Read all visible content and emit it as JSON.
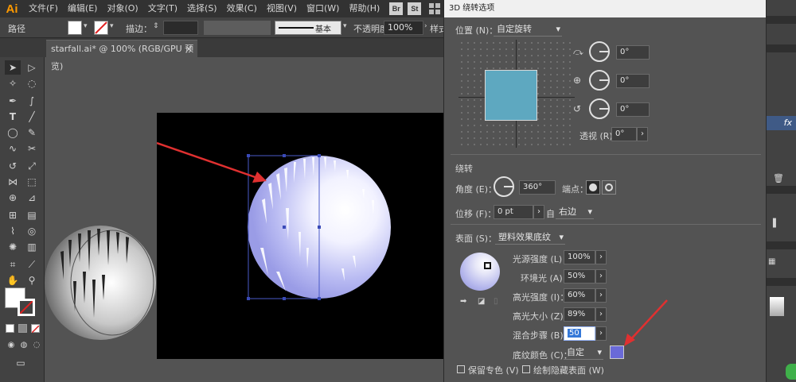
{
  "app": {
    "logo": "Ai"
  },
  "menu": [
    "文件(F)",
    "编辑(E)",
    "对象(O)",
    "文字(T)",
    "选择(S)",
    "效果(C)",
    "视图(V)",
    "窗口(W)",
    "帮助(H)"
  ],
  "menu_icons": [
    {
      "label": "Br",
      "name": "bridge-icon"
    },
    {
      "label": "St",
      "name": "stock-icon"
    }
  ],
  "control_bar": {
    "path_label": "路径",
    "stroke_label": "描边：",
    "stroke_style": "基本",
    "opacity_label": "不透明度：",
    "opacity_value": "100%",
    "style_label": "样式"
  },
  "document": {
    "tab_title": "starfall.ai* @ 100% (RGB/GPU 预览)"
  },
  "dialog": {
    "title": "3D 绕转选项",
    "position_label": "位置 (N)：",
    "position_value": "自定旋转",
    "rot_x": "0°",
    "rot_y": "0°",
    "rot_z": "0°",
    "perspective_label": "透视 (R)：",
    "perspective_value": "0°",
    "revolve_title": "绕转",
    "angle_label": "角度 (E)：",
    "angle_value": "360°",
    "cap_label": "端点：",
    "offset_label": "位移 (F)：",
    "offset_value": "0 pt",
    "from_label": "自",
    "from_value": "右边",
    "surface_label": "表面 (S)：",
    "surface_value": "塑料效果底纹",
    "light_intensity_label": "光源强度 (L)：",
    "light_intensity_value": "100%",
    "ambient_label": "环境光 (A)：",
    "ambient_value": "50%",
    "highlight_intensity_label": "高光强度 (I)：",
    "highlight_intensity_value": "60%",
    "highlight_size_label": "高光大小 (Z)：",
    "highlight_size_value": "89%",
    "blend_steps_label": "混合步骤 (B)：",
    "blend_steps_value": "50",
    "shade_color_label": "底纹颜色 (C)：",
    "shade_color_value": "自定",
    "shade_color_hex": "#6a6ad8",
    "preserve_spot_label": "保留专色 (V)",
    "draw_hidden_label": "绘制隐藏表面 (W)"
  },
  "right_panel": {
    "fx_label": "fx"
  },
  "colors": {
    "cube_face": "#5ea8c0",
    "sphere_tint": "#b0b2f2"
  }
}
